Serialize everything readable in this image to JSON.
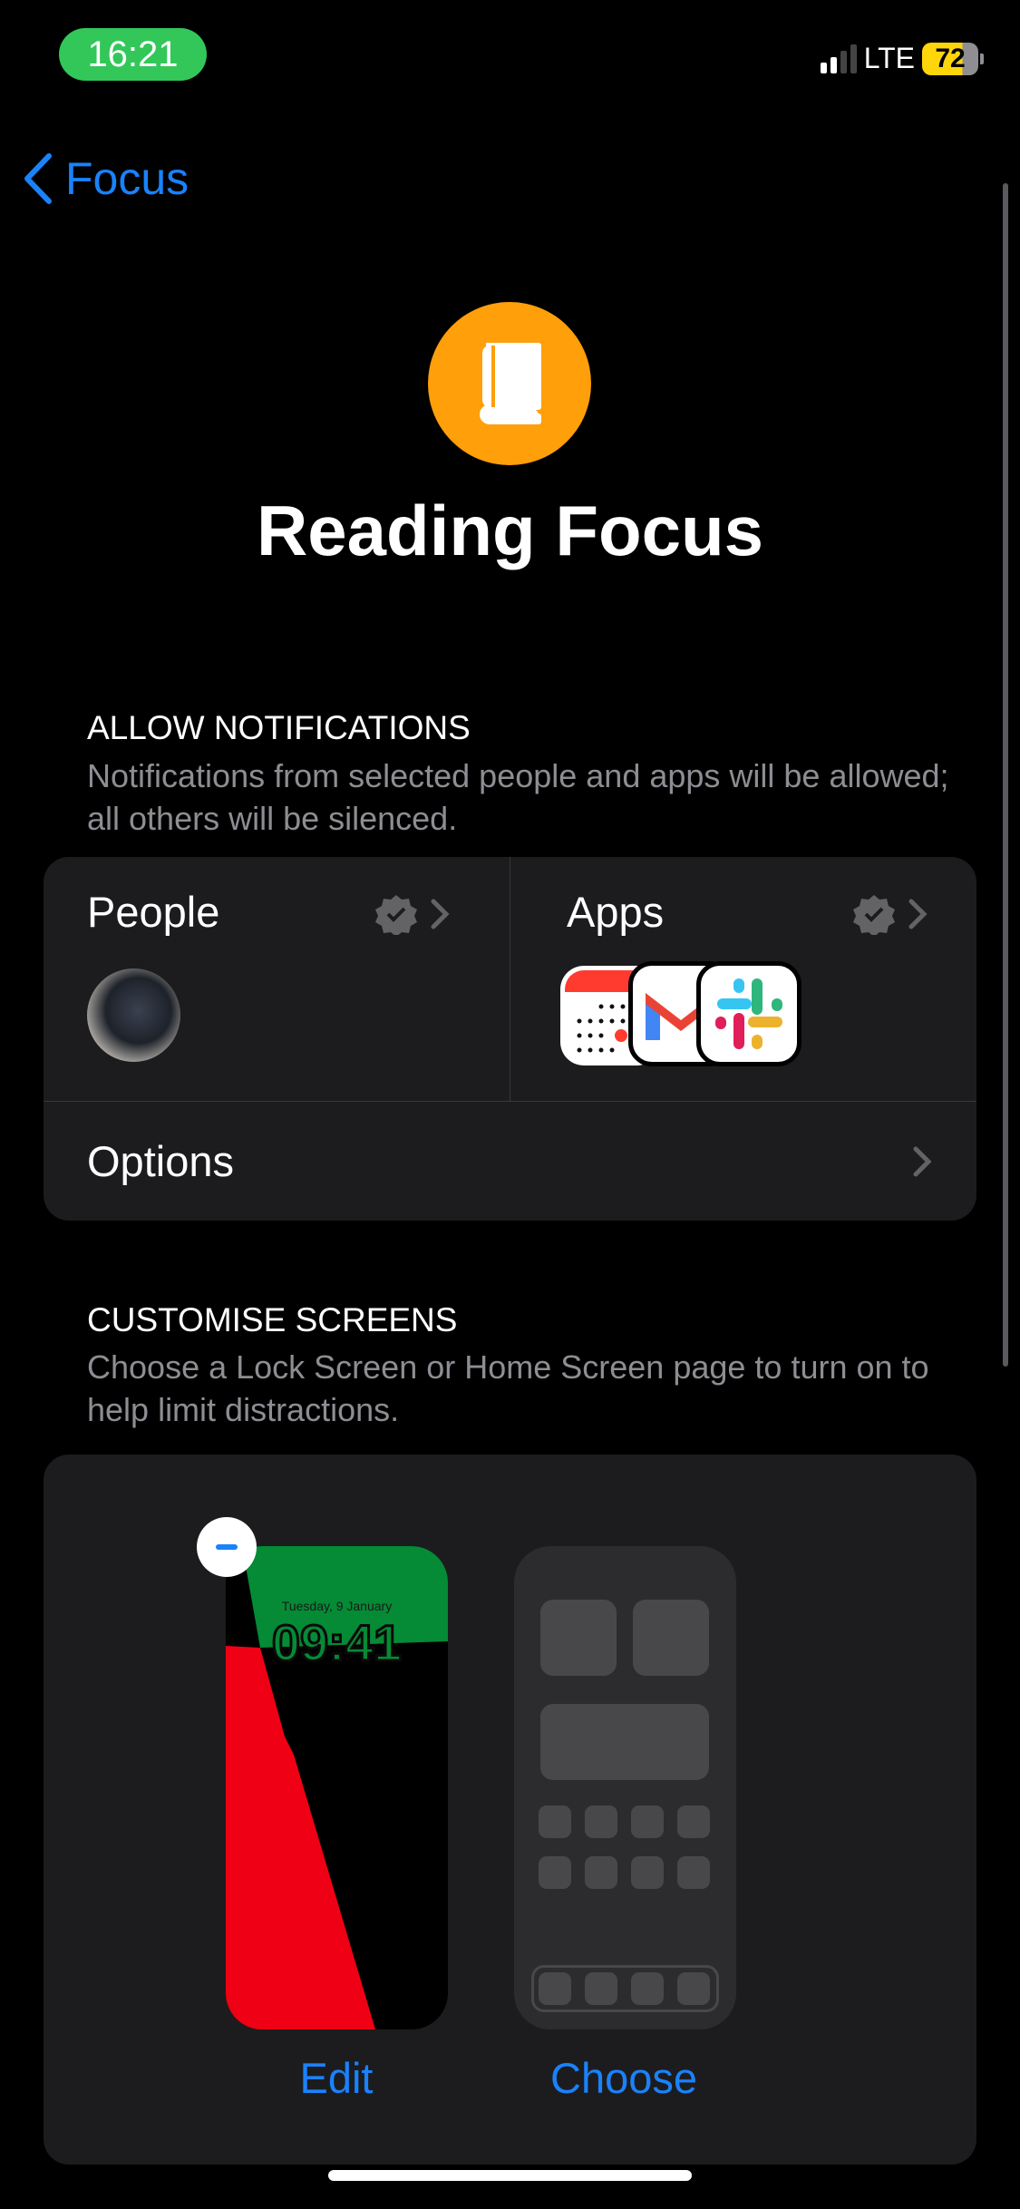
{
  "status_bar": {
    "time": "16:21",
    "network": "LTE",
    "battery_percent": 72,
    "battery_label": "72",
    "signal_bars": 2
  },
  "nav": {
    "back_label": "Focus"
  },
  "focus": {
    "title": "Reading Focus",
    "icon": "book-icon",
    "color": "#ff9f0a"
  },
  "allow_notifications": {
    "header": "ALLOW NOTIFICATIONS",
    "description": "Notifications from selected people and apps will be allowed; all others will be silenced.",
    "people": {
      "label": "People",
      "status_icon": "checkmark-seal-icon"
    },
    "apps": {
      "label": "Apps",
      "status_icon": "checkmark-seal-icon",
      "items": [
        "calendar",
        "gmail",
        "slack"
      ]
    },
    "options": {
      "label": "Options"
    }
  },
  "customise_screens": {
    "header": "CUSTOMISE SCREENS",
    "description": "Choose a Lock Screen or Home Screen page to turn on to help limit distractions.",
    "lock_screen": {
      "date": "Tuesday, 9 January",
      "time": "09:41",
      "action": "Edit"
    },
    "home_screen": {
      "action": "Choose"
    }
  },
  "colors": {
    "accent": "#1a82fb",
    "background": "#000000",
    "card": "#1c1c1e",
    "secondary_text": "#8d8d93"
  }
}
